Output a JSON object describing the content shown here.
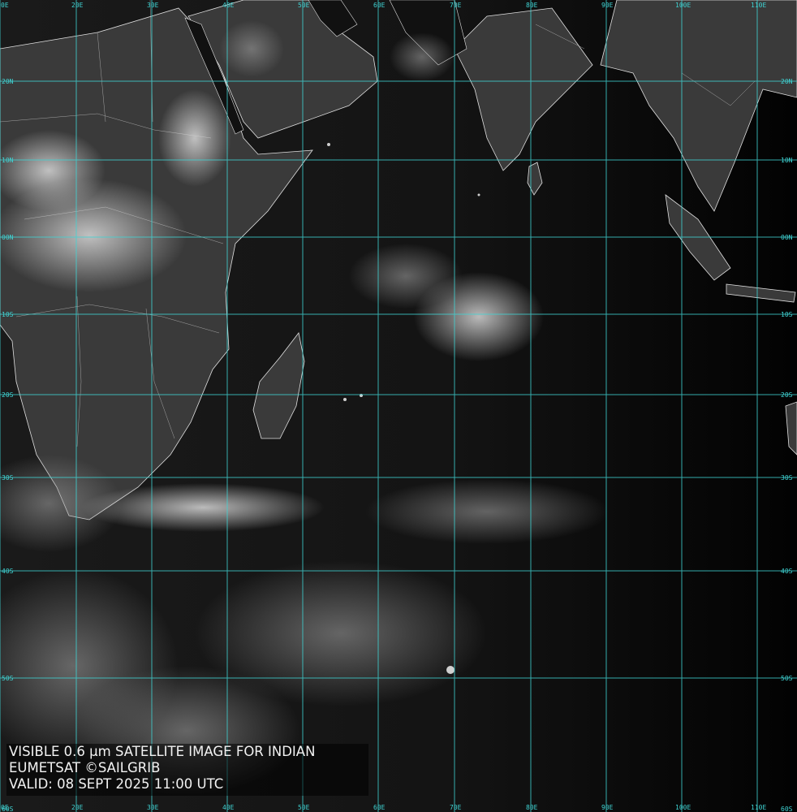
{
  "caption": {
    "line1": "VISIBLE 0.6 µm SATELLITE IMAGE FOR INDIAN",
    "line2": "EUMETSAT ©SAILGRIB",
    "line3": "VALID:  08 SEPT 2025 11:00 UTC"
  },
  "grid": {
    "color": "#3fd4d4",
    "longitudes": [
      "10E",
      "20E",
      "30E",
      "40E",
      "50E",
      "60E",
      "70E",
      "80E",
      "90E",
      "100E",
      "110E"
    ],
    "latitudes": [
      "20N",
      "10N",
      "00N",
      "10S",
      "20S",
      "30S",
      "40S",
      "50S"
    ],
    "corner_labels": [
      "0E",
      "0S",
      "60S"
    ]
  },
  "colors": {
    "land_outline": "#e8e8e8",
    "ocean": "#0c0c0c"
  }
}
